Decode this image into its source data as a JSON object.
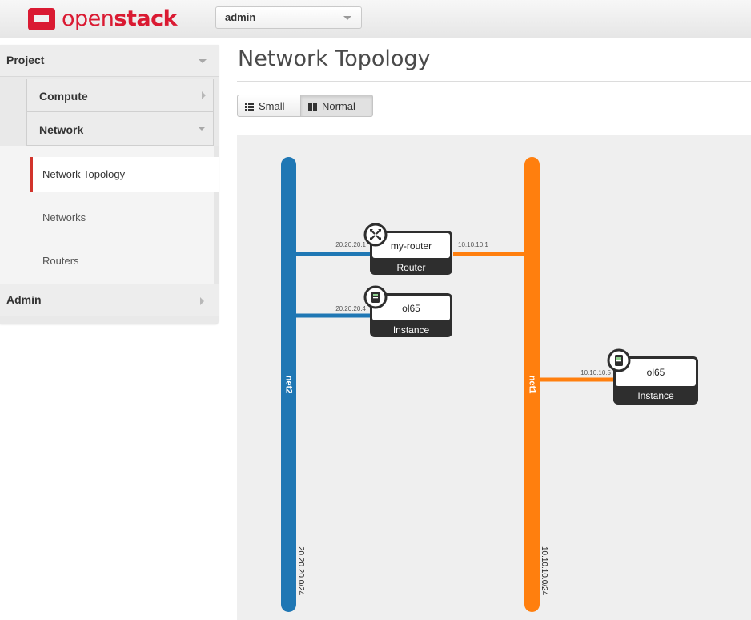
{
  "brand": {
    "name_open": "open",
    "name_stack": "stack"
  },
  "project_selector": {
    "value": "admin"
  },
  "sidebar": {
    "project_label": "Project",
    "compute_label": "Compute",
    "network_label": "Network",
    "items": [
      {
        "label": "Network Topology",
        "active": true
      },
      {
        "label": "Networks",
        "active": false
      },
      {
        "label": "Routers",
        "active": false
      }
    ],
    "admin_label": "Admin"
  },
  "main": {
    "title": "Network Topology",
    "view_toggle": {
      "small_label": "Small",
      "normal_label": "Normal",
      "selected": "Normal"
    }
  },
  "topology": {
    "networks": [
      {
        "name": "net2",
        "cidr": "20.20.20.0/24",
        "color": "#1f77b4"
      },
      {
        "name": "net1",
        "cidr": "10.10.10.0/24",
        "color": "#ff7f0e"
      }
    ],
    "devices": [
      {
        "name": "my-router",
        "type": "Router",
        "ports": [
          {
            "network": "net2",
            "ip": "20.20.20.1"
          },
          {
            "network": "net1",
            "ip": "10.10.10.1"
          }
        ]
      },
      {
        "name": "ol65",
        "type": "Instance",
        "ports": [
          {
            "network": "net2",
            "ip": "20.20.20.4"
          }
        ]
      },
      {
        "name": "ol65",
        "type": "Instance",
        "ports": [
          {
            "network": "net1",
            "ip": "10.10.10.5"
          }
        ]
      }
    ]
  }
}
